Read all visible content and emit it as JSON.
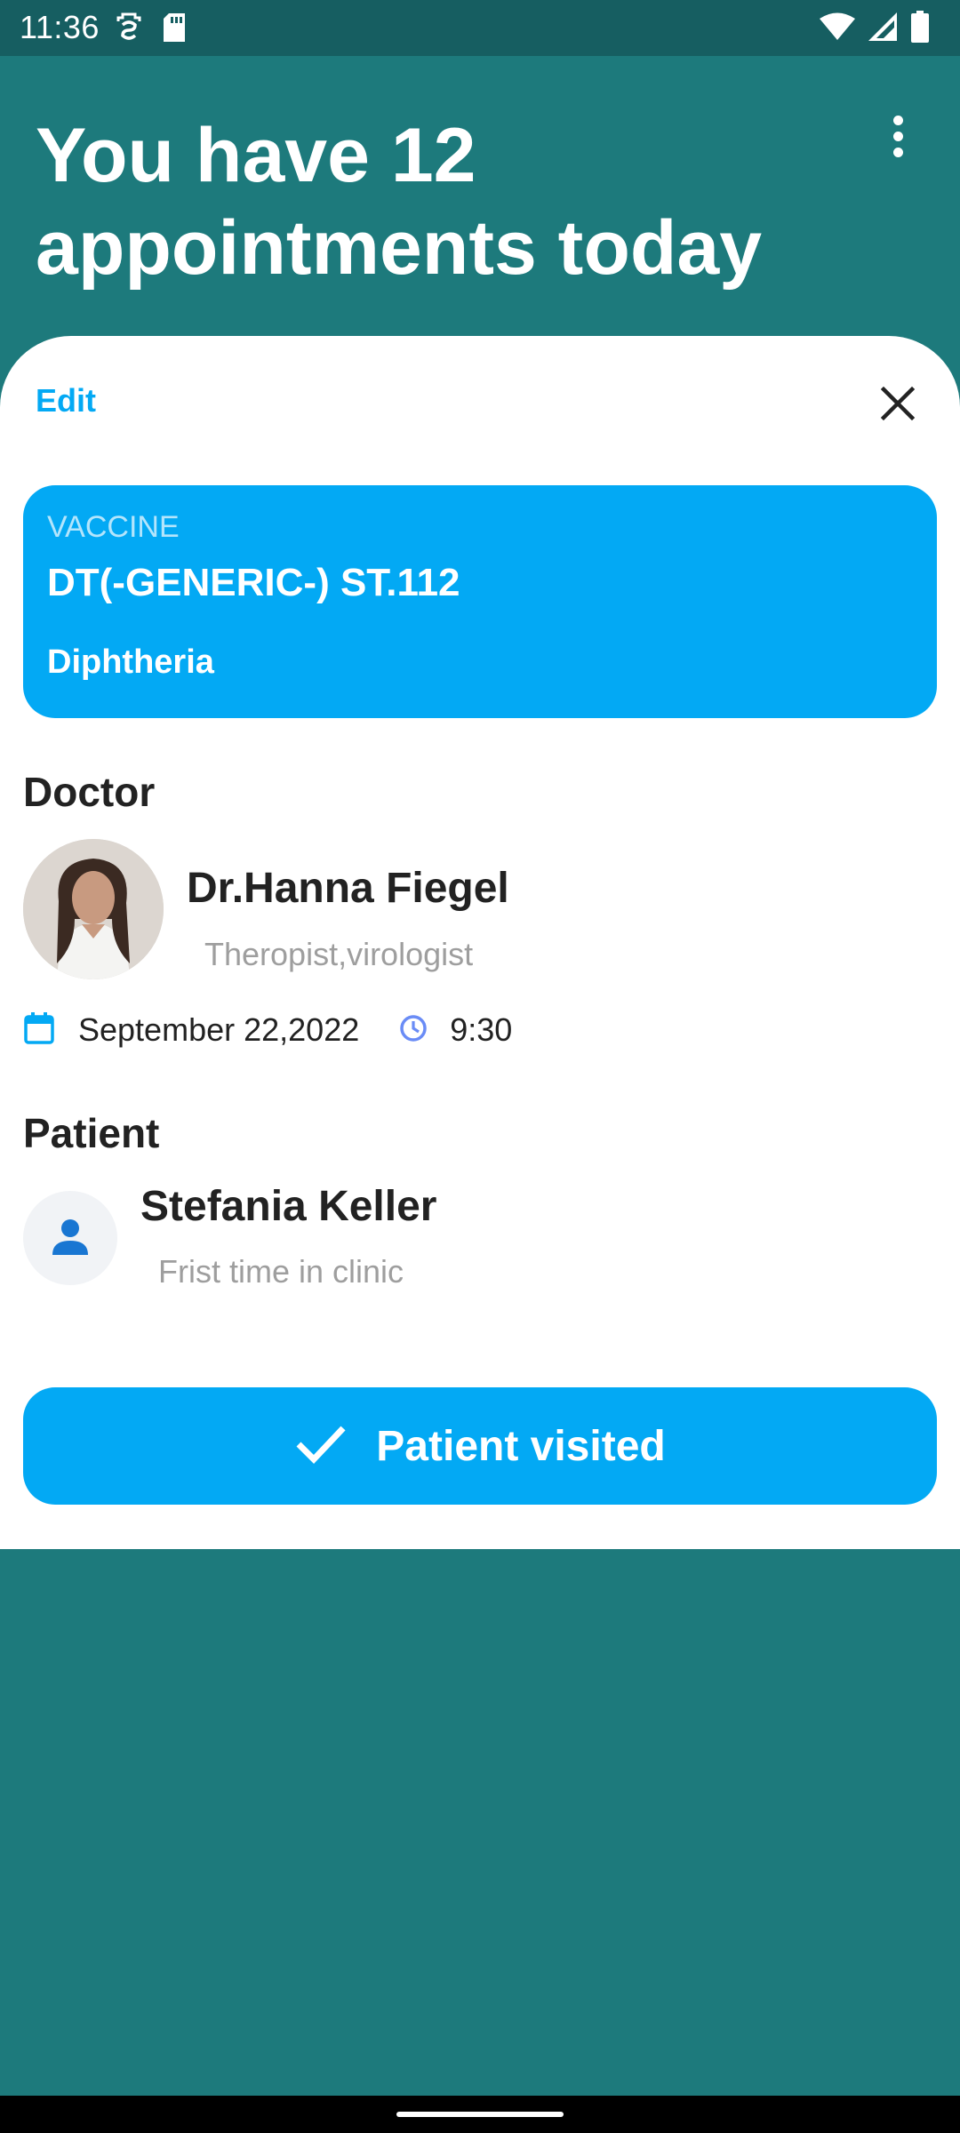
{
  "status_bar": {
    "time": "11:36",
    "icons": [
      "notification-icon",
      "sd-card-icon",
      "wifi-icon",
      "signal-icon",
      "battery-icon"
    ]
  },
  "header": {
    "title": "You have 12 appointments today",
    "menu_icon": "more-vert-icon"
  },
  "sheet": {
    "edit_label": "Edit",
    "close_icon": "close-icon",
    "vaccine": {
      "label": "VACCINE",
      "name": "DT(-GENERIC-) ST.112",
      "disease": "Diphtheria"
    },
    "doctor": {
      "section_title": "Doctor",
      "name": "Dr.Hanna Fiegel",
      "role": "Theropist,virologist",
      "date": "September 22,2022",
      "time": "9:30"
    },
    "patient": {
      "section_title": "Patient",
      "name": "Stefania Keller",
      "note": "Frist time in clinic"
    },
    "action_button": {
      "label": "Patient visited",
      "icon": "check-icon"
    }
  },
  "colors": {
    "header_bg": "#1d7a7c",
    "status_bg": "#165e61",
    "accent": "#03a9f4",
    "text_primary": "#222222",
    "text_secondary": "#9e9e9e"
  }
}
